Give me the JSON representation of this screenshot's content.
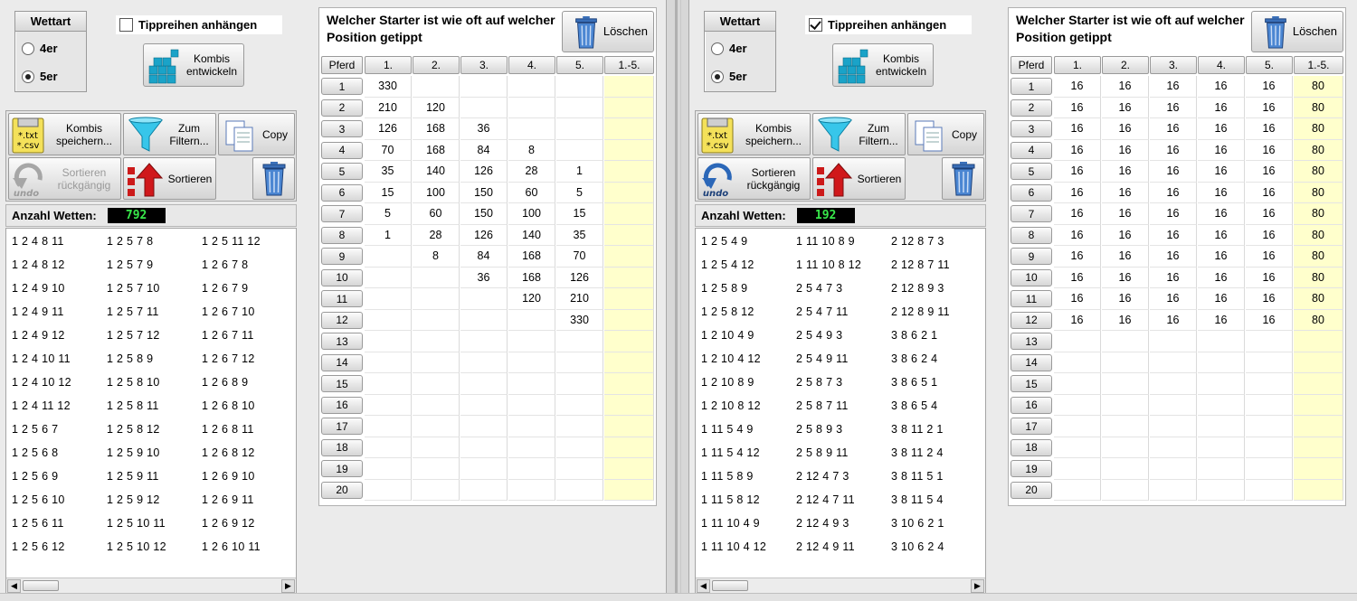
{
  "left": {
    "wettart_title": "Wettart",
    "option_4er": "4er",
    "option_5er": "5er",
    "selected": "5er",
    "append_label": "Tippreihen anhängen",
    "append_checked": false,
    "kombis_entwickeln": "Kombis entwickeln",
    "kombis_speichern": "Kombis speichern...",
    "csv_icon_text": "*.txt *.csv",
    "zum_filtern": "Zum Filtern...",
    "copy": "Copy",
    "sortieren_rueck": "Sortieren rückgängig",
    "undo_icon_text": "undo",
    "sortieren": "Sortieren",
    "undo_enabled": false,
    "anzahl_label": "Anzahl Wetten:",
    "anzahl_value": "792",
    "list_columns": [
      [
        "1 2 4 8 11",
        "1 2 4 8 12",
        "1 2 4 9 10",
        "1 2 4 9 11",
        "1 2 4 9 12",
        "1 2 4 10 11",
        "1 2 4 10 12",
        "1 2 4 11 12",
        "1 2 5 6 7",
        "1 2 5 6 8",
        "1 2 5 6 9",
        "1 2 5 6 10",
        "1 2 5 6 11",
        "1 2 5 6 12"
      ],
      [
        "1 2 5 7 8",
        "1 2 5 7 9",
        "1 2 5 7 10",
        "1 2 5 7 11",
        "1 2 5 7 12",
        "1 2 5 8 9",
        "1 2 5 8 10",
        "1 2 5 8 11",
        "1 2 5 8 12",
        "1 2 5 9 10",
        "1 2 5 9 11",
        "1 2 5 9 12",
        "1 2 5 10 11",
        "1 2 5 10 12"
      ],
      [
        "1 2 5 11 12",
        "1 2 6 7 8",
        "1 2 6 7 9",
        "1 2 6 7 10",
        "1 2 6 7 11",
        "1 2 6 7 12",
        "1 2 6 8 9",
        "1 2 6 8 10",
        "1 2 6 8 11",
        "1 2 6 8 12",
        "1 2 6 9 10",
        "1 2 6 9 11",
        "1 2 6 9 12",
        "1 2 6 10 11"
      ]
    ],
    "stats_title": "Welcher Starter ist wie oft auf welcher Position getippt",
    "loeschen": "Löschen",
    "headers": [
      "Pferd",
      "1.",
      "2.",
      "3.",
      "4.",
      "5.",
      "1.-5."
    ],
    "rows": [
      {
        "pferd": "1",
        "vals": [
          "330",
          "",
          "",
          "",
          "",
          ""
        ]
      },
      {
        "pferd": "2",
        "vals": [
          "210",
          "120",
          "",
          "",
          "",
          ""
        ]
      },
      {
        "pferd": "3",
        "vals": [
          "126",
          "168",
          "36",
          "",
          "",
          ""
        ]
      },
      {
        "pferd": "4",
        "vals": [
          "70",
          "168",
          "84",
          "8",
          "",
          ""
        ]
      },
      {
        "pferd": "5",
        "vals": [
          "35",
          "140",
          "126",
          "28",
          "1",
          ""
        ]
      },
      {
        "pferd": "6",
        "vals": [
          "15",
          "100",
          "150",
          "60",
          "5",
          ""
        ]
      },
      {
        "pferd": "7",
        "vals": [
          "5",
          "60",
          "150",
          "100",
          "15",
          ""
        ]
      },
      {
        "pferd": "8",
        "vals": [
          "1",
          "28",
          "126",
          "140",
          "35",
          ""
        ]
      },
      {
        "pferd": "9",
        "vals": [
          "",
          "8",
          "84",
          "168",
          "70",
          ""
        ]
      },
      {
        "pferd": "10",
        "vals": [
          "",
          "",
          "36",
          "168",
          "126",
          ""
        ]
      },
      {
        "pferd": "11",
        "vals": [
          "",
          "",
          "",
          "120",
          "210",
          ""
        ]
      },
      {
        "pferd": "12",
        "vals": [
          "",
          "",
          "",
          "",
          "330",
          ""
        ]
      },
      {
        "pferd": "13",
        "vals": [
          "",
          "",
          "",
          "",
          "",
          ""
        ]
      },
      {
        "pferd": "14",
        "vals": [
          "",
          "",
          "",
          "",
          "",
          ""
        ]
      },
      {
        "pferd": "15",
        "vals": [
          "",
          "",
          "",
          "",
          "",
          ""
        ]
      },
      {
        "pferd": "16",
        "vals": [
          "",
          "",
          "",
          "",
          "",
          ""
        ]
      },
      {
        "pferd": "17",
        "vals": [
          "",
          "",
          "",
          "",
          "",
          ""
        ]
      },
      {
        "pferd": "18",
        "vals": [
          "",
          "",
          "",
          "",
          "",
          ""
        ]
      },
      {
        "pferd": "19",
        "vals": [
          "",
          "",
          "",
          "",
          "",
          ""
        ]
      },
      {
        "pferd": "20",
        "vals": [
          "",
          "",
          "",
          "",
          "",
          ""
        ]
      }
    ]
  },
  "right": {
    "wettart_title": "Wettart",
    "option_4er": "4er",
    "option_5er": "5er",
    "selected": "5er",
    "append_label": "Tippreihen anhängen",
    "append_checked": true,
    "kombis_entwickeln": "Kombis entwickeln",
    "kombis_speichern": "Kombis speichern...",
    "csv_icon_text": "*.txt *.csv",
    "zum_filtern": "Zum Filtern...",
    "copy": "Copy",
    "sortieren_rueck": "Sortieren rückgängig",
    "undo_icon_text": "undo",
    "sortieren": "Sortieren",
    "undo_enabled": true,
    "anzahl_label": "Anzahl Wetten:",
    "anzahl_value": "192",
    "list_columns": [
      [
        "1 2 5 4 9",
        "1 2 5 4 12",
        "1 2 5 8 9",
        "1 2 5 8 12",
        "1 2 10 4 9",
        "1 2 10 4 12",
        "1 2 10 8 9",
        "1 2 10 8 12",
        "1 11 5 4 9",
        "1 11 5 4 12",
        "1 11 5 8 9",
        "1 11 5 8 12",
        "1 11 10 4 9",
        "1 11 10 4 12"
      ],
      [
        "1 11 10 8 9",
        "1 11 10 8 12",
        "2 5 4 7 3",
        "2 5 4 7 11",
        "2 5 4 9 3",
        "2 5 4 9 11",
        "2 5 8 7 3",
        "2 5 8 7 11",
        "2 5 8 9 3",
        "2 5 8 9 11",
        "2 12 4 7 3",
        "2 12 4 7 11",
        "2 12 4 9 3",
        "2 12 4 9 11"
      ],
      [
        "2 12 8 7 3",
        "2 12 8 7 11",
        "2 12 8 9 3",
        "2 12 8 9 11",
        "3 8 6 2 1",
        "3 8 6 2 4",
        "3 8 6 5 1",
        "3 8 6 5 4",
        "3 8 11 2 1",
        "3 8 11 2 4",
        "3 8 11 5 1",
        "3 8 11 5 4",
        "3 10 6 2 1",
        "3 10 6 2 4"
      ]
    ],
    "stats_title": "Welcher Starter ist wie oft auf welcher Position getippt",
    "loeschen": "Löschen",
    "headers": [
      "Pferd",
      "1.",
      "2.",
      "3.",
      "4.",
      "5.",
      "1.-5."
    ],
    "rows": [
      {
        "pferd": "1",
        "vals": [
          "16",
          "16",
          "16",
          "16",
          "16",
          "80"
        ]
      },
      {
        "pferd": "2",
        "vals": [
          "16",
          "16",
          "16",
          "16",
          "16",
          "80"
        ]
      },
      {
        "pferd": "3",
        "vals": [
          "16",
          "16",
          "16",
          "16",
          "16",
          "80"
        ]
      },
      {
        "pferd": "4",
        "vals": [
          "16",
          "16",
          "16",
          "16",
          "16",
          "80"
        ]
      },
      {
        "pferd": "5",
        "vals": [
          "16",
          "16",
          "16",
          "16",
          "16",
          "80"
        ]
      },
      {
        "pferd": "6",
        "vals": [
          "16",
          "16",
          "16",
          "16",
          "16",
          "80"
        ]
      },
      {
        "pferd": "7",
        "vals": [
          "16",
          "16",
          "16",
          "16",
          "16",
          "80"
        ]
      },
      {
        "pferd": "8",
        "vals": [
          "16",
          "16",
          "16",
          "16",
          "16",
          "80"
        ]
      },
      {
        "pferd": "9",
        "vals": [
          "16",
          "16",
          "16",
          "16",
          "16",
          "80"
        ]
      },
      {
        "pferd": "10",
        "vals": [
          "16",
          "16",
          "16",
          "16",
          "16",
          "80"
        ]
      },
      {
        "pferd": "11",
        "vals": [
          "16",
          "16",
          "16",
          "16",
          "16",
          "80"
        ]
      },
      {
        "pferd": "12",
        "vals": [
          "16",
          "16",
          "16",
          "16",
          "16",
          "80"
        ]
      },
      {
        "pferd": "13",
        "vals": [
          "",
          "",
          "",
          "",
          "",
          ""
        ]
      },
      {
        "pferd": "14",
        "vals": [
          "",
          "",
          "",
          "",
          "",
          ""
        ]
      },
      {
        "pferd": "15",
        "vals": [
          "",
          "",
          "",
          "",
          "",
          ""
        ]
      },
      {
        "pferd": "16",
        "vals": [
          "",
          "",
          "",
          "",
          "",
          ""
        ]
      },
      {
        "pferd": "17",
        "vals": [
          "",
          "",
          "",
          "",
          "",
          ""
        ]
      },
      {
        "pferd": "18",
        "vals": [
          "",
          "",
          "",
          "",
          "",
          ""
        ]
      },
      {
        "pferd": "19",
        "vals": [
          "",
          "",
          "",
          "",
          "",
          ""
        ]
      },
      {
        "pferd": "20",
        "vals": [
          "",
          "",
          "",
          "",
          "",
          ""
        ]
      }
    ]
  }
}
